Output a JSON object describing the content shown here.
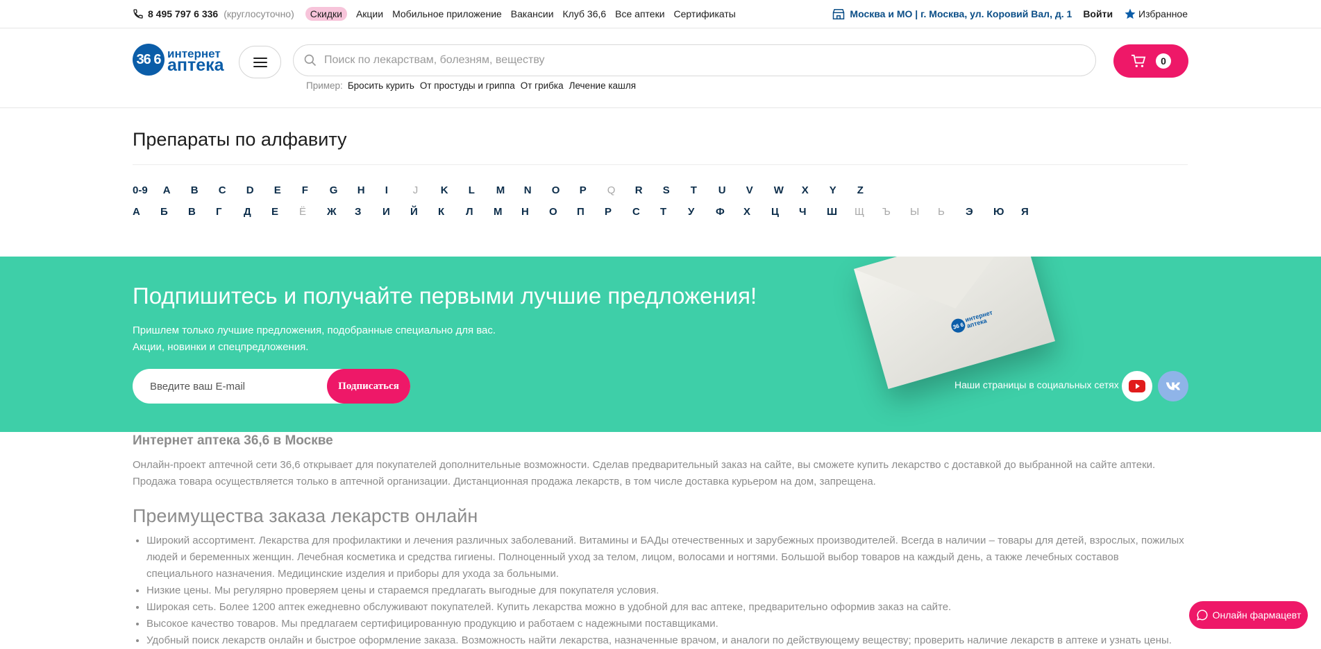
{
  "topbar": {
    "phone": "8 495 797 6 336",
    "phone_note": "(круглосуточно)",
    "nav": [
      "Скидки",
      "Акции",
      "Мобильное приложение",
      "Вакансии",
      "Клуб 36,6",
      "Все аптеки",
      "Сертификаты"
    ],
    "location": "Москва и МО | г. Москва, ул. Коровий Вал, д. 1",
    "login": "Войти",
    "favorites": "Избранное"
  },
  "header": {
    "logo_number": "36 6",
    "logo_line1": "интернет",
    "logo_line2": "аптека",
    "search_placeholder": "Поиск по лекарствам, болезням, веществу",
    "examples_label": "Пример:",
    "examples": [
      "Бросить курить",
      "От простуды и гриппа",
      "От грибка",
      "Лечение кашля"
    ],
    "cart_count": "0"
  },
  "alphabet": {
    "title": "Препараты по алфавиту",
    "latin": [
      {
        "l": "0-9",
        "on": true
      },
      {
        "l": "A",
        "on": true
      },
      {
        "l": "B",
        "on": true
      },
      {
        "l": "C",
        "on": true
      },
      {
        "l": "D",
        "on": true
      },
      {
        "l": "E",
        "on": true
      },
      {
        "l": "F",
        "on": true
      },
      {
        "l": "G",
        "on": true
      },
      {
        "l": "H",
        "on": true
      },
      {
        "l": "I",
        "on": true
      },
      {
        "l": "J",
        "on": false
      },
      {
        "l": "K",
        "on": true
      },
      {
        "l": "L",
        "on": true
      },
      {
        "l": "M",
        "on": true
      },
      {
        "l": "N",
        "on": true
      },
      {
        "l": "O",
        "on": true
      },
      {
        "l": "P",
        "on": true
      },
      {
        "l": "Q",
        "on": false
      },
      {
        "l": "R",
        "on": true
      },
      {
        "l": "S",
        "on": true
      },
      {
        "l": "T",
        "on": true
      },
      {
        "l": "U",
        "on": true
      },
      {
        "l": "V",
        "on": true
      },
      {
        "l": "W",
        "on": true
      },
      {
        "l": "X",
        "on": true
      },
      {
        "l": "Y",
        "on": true
      },
      {
        "l": "Z",
        "on": true
      }
    ],
    "cyrillic": [
      {
        "l": "А",
        "on": true
      },
      {
        "l": "Б",
        "on": true
      },
      {
        "l": "В",
        "on": true
      },
      {
        "l": "Г",
        "on": true
      },
      {
        "l": "Д",
        "on": true
      },
      {
        "l": "Е",
        "on": true
      },
      {
        "l": "Ё",
        "on": false
      },
      {
        "l": "Ж",
        "on": true
      },
      {
        "l": "З",
        "on": true
      },
      {
        "l": "И",
        "on": true
      },
      {
        "l": "Й",
        "on": true
      },
      {
        "l": "К",
        "on": true
      },
      {
        "l": "Л",
        "on": true
      },
      {
        "l": "М",
        "on": true
      },
      {
        "l": "Н",
        "on": true
      },
      {
        "l": "О",
        "on": true
      },
      {
        "l": "П",
        "on": true
      },
      {
        "l": "Р",
        "on": true
      },
      {
        "l": "С",
        "on": true
      },
      {
        "l": "Т",
        "on": true
      },
      {
        "l": "У",
        "on": true
      },
      {
        "l": "Ф",
        "on": true
      },
      {
        "l": "Х",
        "on": true
      },
      {
        "l": "Ц",
        "on": true
      },
      {
        "l": "Ч",
        "on": true
      },
      {
        "l": "Ш",
        "on": true
      },
      {
        "l": "Щ",
        "on": false
      },
      {
        "l": "Ъ",
        "on": false
      },
      {
        "l": "Ы",
        "on": false
      },
      {
        "l": "Ь",
        "on": false
      },
      {
        "l": "Э",
        "on": true
      },
      {
        "l": "Ю",
        "on": true
      },
      {
        "l": "Я",
        "on": true
      }
    ]
  },
  "subscribe": {
    "title": "Подпишитесь и получайте первыми лучшие предложения!",
    "line1": "Пришлем только лучшие предложения, подобранные специально для вас.",
    "line2": "Акции, новинки и спецпредложения.",
    "email_placeholder": "Введите ваш E-mail",
    "button": "Подписаться",
    "envelope_logo_number": "36 6",
    "envelope_logo_line1": "интернет",
    "envelope_logo_line2": "аптека",
    "social_label": "Наши страницы в социальных сетях"
  },
  "seo": {
    "title": "Интернет аптека 36,6 в Москве",
    "para": "Онлайн-проект аптечной сети 36,6 открывает для покупателей дополнительные возможности. Сделав предварительный заказ на сайте, вы сможете купить лекарство с доставкой до выбранной на сайте аптеки. Продажа товара осуществляется только в аптечной организации. Дистанционная продажа лекарств, в том числе доставка курьером на дом, запрещена.",
    "benefits_title": "Преимущества заказа лекарств онлайн",
    "benefits": [
      "Широкий ассортимент. Лекарства для профилактики и лечения различных заболеваний. Витамины и БАДы отечественных и зарубежных производителей. Всегда в наличии – товары для детей, взрослых, пожилых людей и беременных женщин. Лечебная косметика и средства гигиены. Полноценный уход за телом, лицом, волосами и ногтями. Большой выбор товаров на каждый день, а также лечебных составов специального назначения. Медицинские изделия и приборы для ухода за больными.",
      "Низкие цены. Мы регулярно проверяем цены и стараемся предлагать выгодные для покупателя условия.",
      "Широкая сеть. Более 1200 аптек ежедневно обслуживают покупателей. Купить лекарства можно в удобной для вас аптеке, предварительно оформив заказ на сайте.",
      "Высокое качество товаров. Мы предлагаем сертифицированную продукцию и работаем с надежными поставщиками.",
      "Удобный поиск лекарств онлайн и быстрое оформление заказа. Возможность найти лекарства, назначенные врачом, и аналоги по действующему веществу; проверить наличие лекарств в аптеке и узнать цены."
    ]
  },
  "pharmacist_button": "Онлайн фармацевт"
}
